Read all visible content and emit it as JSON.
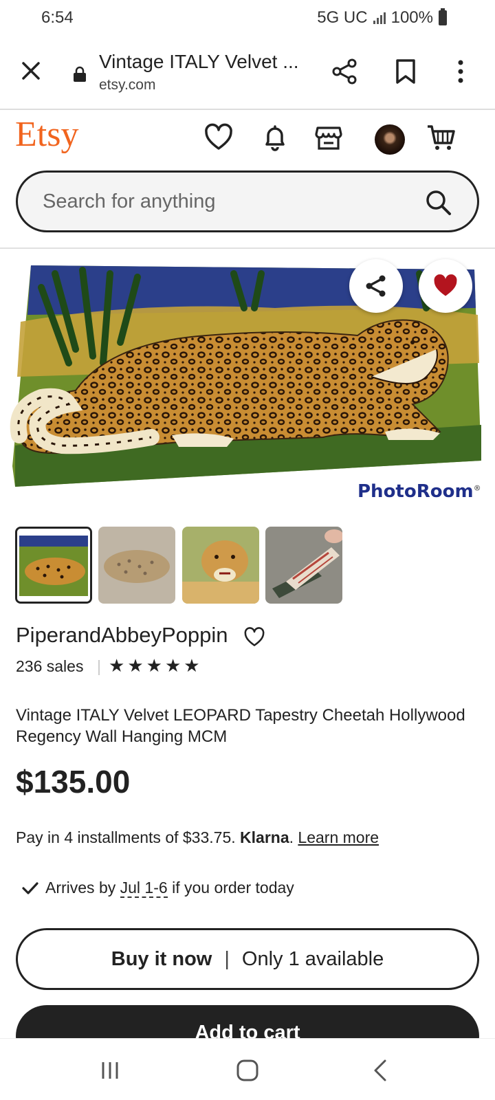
{
  "status_bar": {
    "time": "6:54",
    "network": "5G UC",
    "battery": "100%"
  },
  "browser": {
    "title": "Vintage ITALY Velvet ...",
    "domain": "etsy.com",
    "icons": [
      "close-icon",
      "lock-icon",
      "share-icon",
      "bookmark-icon",
      "more-icon"
    ]
  },
  "header": {
    "logo": "Etsy",
    "icons": [
      "heart-icon",
      "bell-icon",
      "shop-icon",
      "avatar",
      "cart-icon"
    ],
    "brand_color": "#f1641e"
  },
  "search": {
    "placeholder": "Search for anything"
  },
  "gallery": {
    "watermark": "PhotoRoom",
    "thumbnail_count": 4,
    "selected_thumbnail": 1,
    "favorite_color": "#b3141e"
  },
  "shop": {
    "name": "PiperandAbbeyPoppin",
    "sales": "236 sales",
    "rating": 5
  },
  "listing": {
    "title": "Vintage ITALY Velvet LEOPARD Tapestry Cheetah Hollywood Regency Wall Hanging MCM",
    "price": "$135.00",
    "installments_prefix": "Pay in 4 installments of $33.75.",
    "klarna": "Klarna",
    "learn_more": "Learn more",
    "arrives_prefix": "Arrives by",
    "arrives_dates": "Jul 1-6",
    "arrives_suffix": "if you order today"
  },
  "actions": {
    "buy_now": "Buy it now",
    "availability": "Only 1 available",
    "add_to_cart": "Add to cart"
  }
}
